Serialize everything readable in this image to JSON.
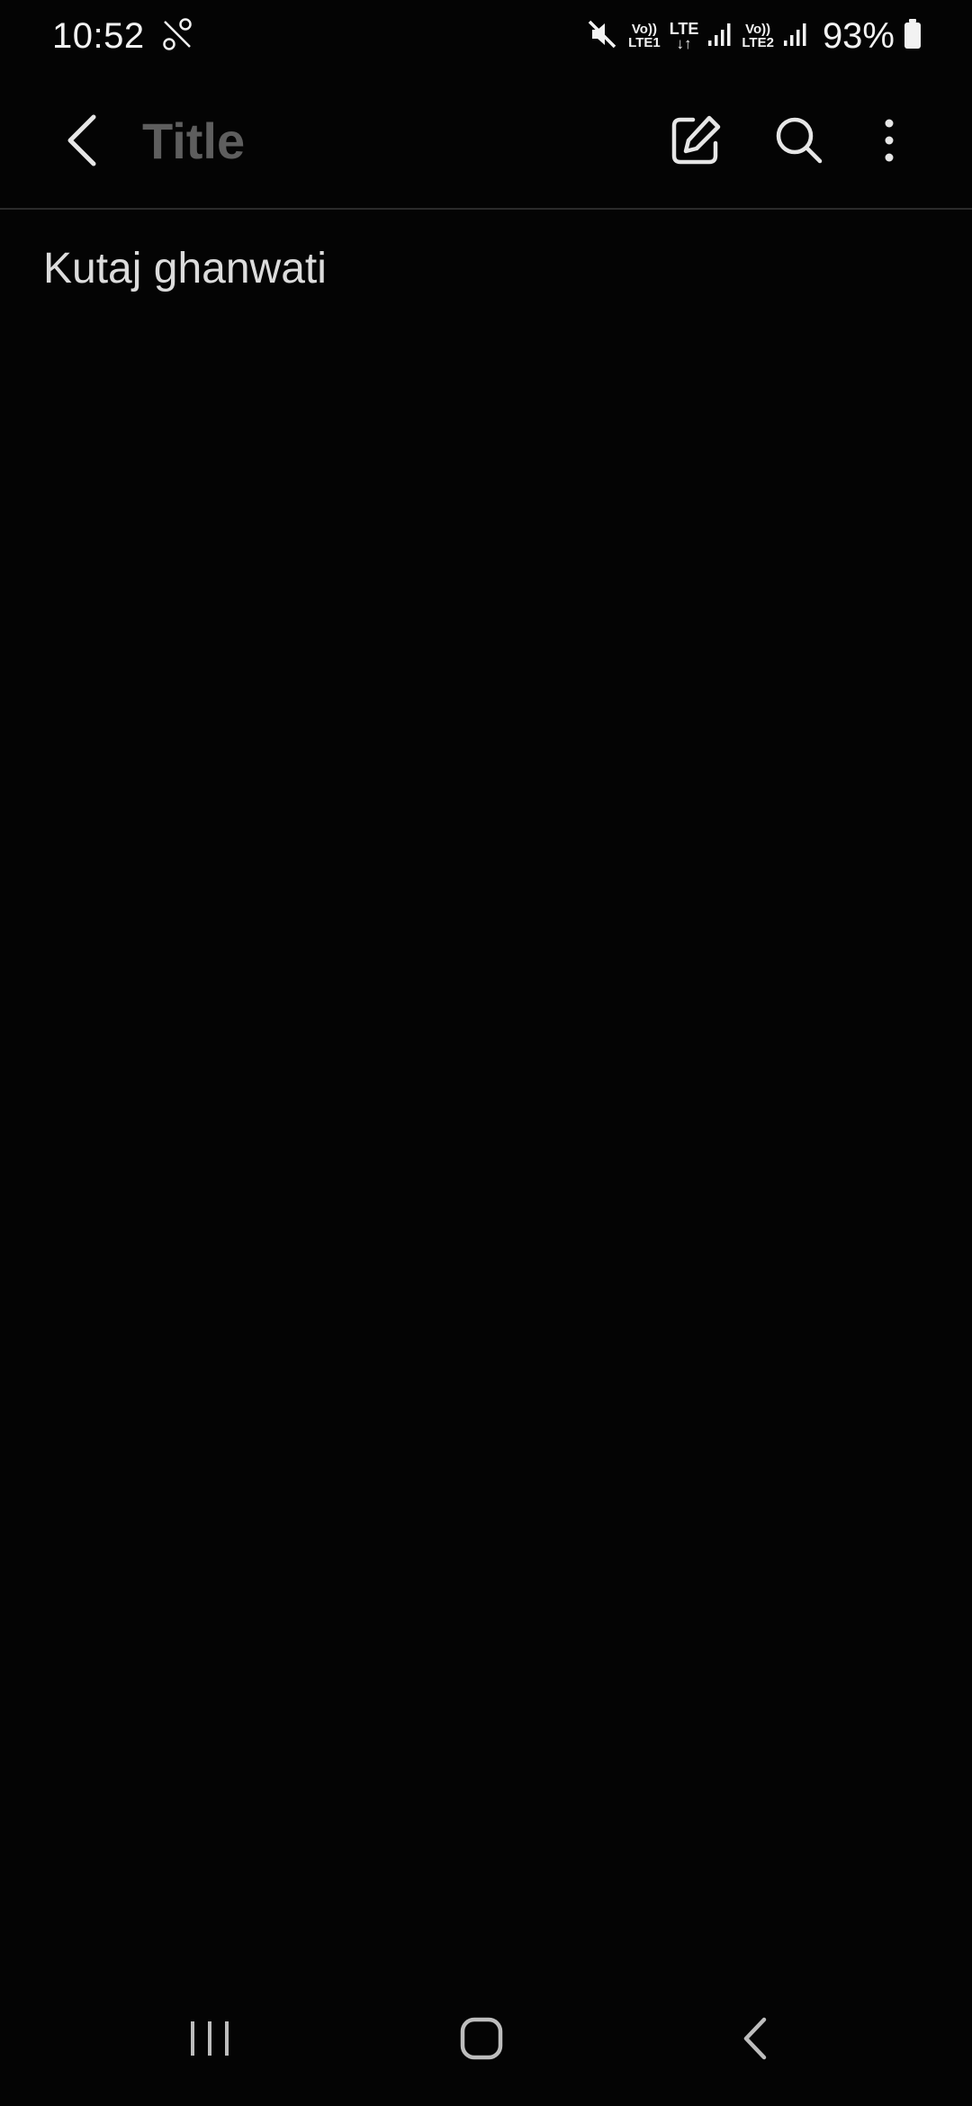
{
  "status_bar": {
    "time": "10:52",
    "net1_top": "Vo))",
    "net1_bottom": "LTE1",
    "lte_top": "LTE",
    "lte_bottom": "↓↑",
    "net2_top": "Vo))",
    "net2_bottom": "LTE2",
    "battery": "93%"
  },
  "app_bar": {
    "title_placeholder": "Title",
    "icons": [
      "back-arrow-icon",
      "edit-icon",
      "search-icon",
      "more-options-icon"
    ]
  },
  "note": {
    "body": "Kutaj ghanwati"
  },
  "nav_bar": {
    "icons": [
      "recents-icon",
      "home-icon",
      "back-icon"
    ]
  },
  "colors": {
    "background": "#040404",
    "placeholder": "#5e5e5e",
    "text": "#dcdcdc",
    "divider": "#2b2b2b"
  }
}
